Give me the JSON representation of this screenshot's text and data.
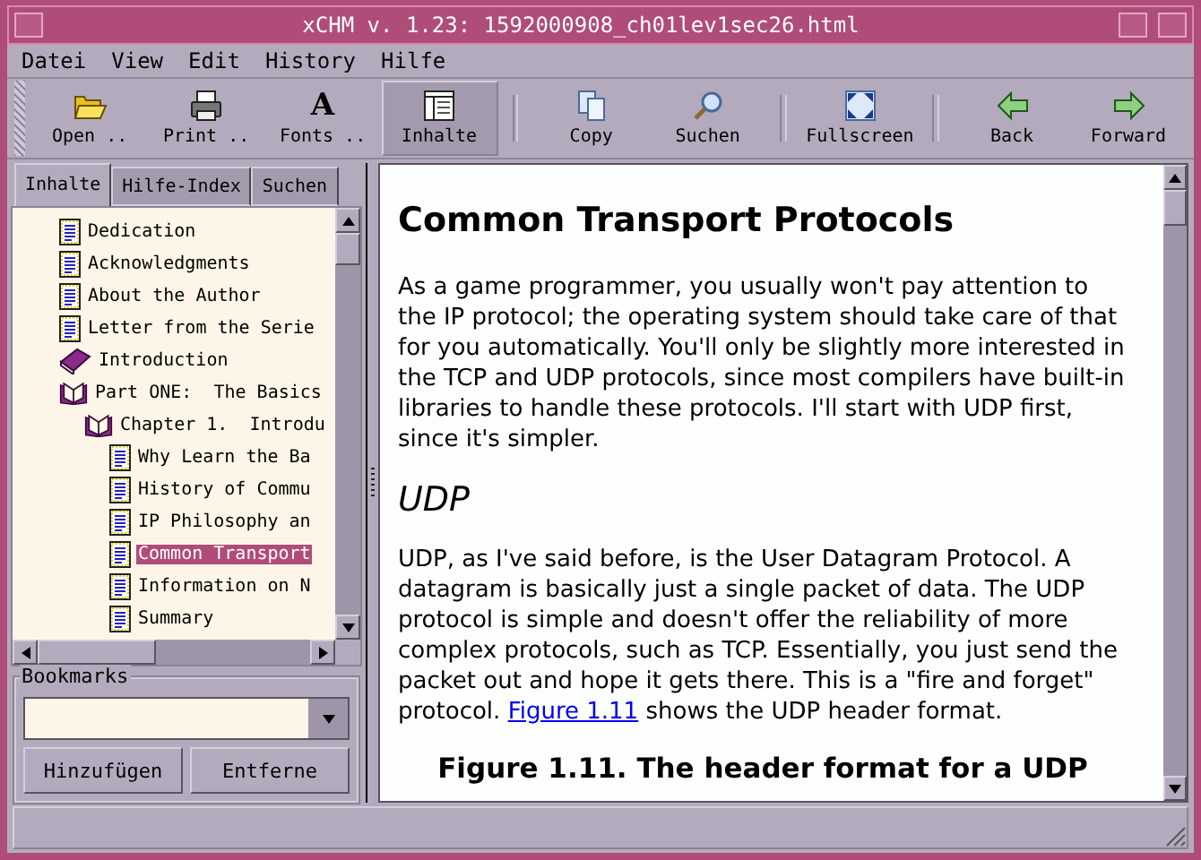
{
  "window": {
    "title": "xCHM v. 1.23: 1592000908_ch01lev1sec26.html"
  },
  "menu": [
    "Datei",
    "View",
    "Edit",
    "History",
    "Hilfe"
  ],
  "toolbar": [
    {
      "kind": "button",
      "label": "Open ..",
      "selected": false
    },
    {
      "kind": "button",
      "label": "Print ..",
      "selected": false
    },
    {
      "kind": "button",
      "glyph": "A",
      "label": "Fonts ..",
      "selected": false
    },
    {
      "kind": "button",
      "label": "Inhalte",
      "selected": true
    },
    {
      "kind": "separator"
    },
    {
      "kind": "button",
      "label": "Copy",
      "selected": false
    },
    {
      "kind": "button",
      "label": "Suchen",
      "selected": false
    },
    {
      "kind": "separator"
    },
    {
      "kind": "button",
      "label": "Fullscreen",
      "selected": false
    },
    {
      "kind": "separator"
    },
    {
      "kind": "button",
      "label": "Back",
      "selected": false
    },
    {
      "kind": "button",
      "label": "Forward",
      "selected": false
    }
  ],
  "sidebar": {
    "tabs": [
      {
        "label": "Inhalte",
        "selected": true
      },
      {
        "label": "Hilfe-Index",
        "selected": false
      },
      {
        "label": "Suchen",
        "selected": false
      }
    ],
    "tree": [
      {
        "kind": "page",
        "label": "Dedication",
        "selected": false
      },
      {
        "kind": "page",
        "label": "Acknowledgments",
        "selected": false
      },
      {
        "kind": "page",
        "label": "About the Author",
        "selected": false
      },
      {
        "kind": "page",
        "label": "Letter from the Serie",
        "selected": false
      },
      {
        "kind": "book",
        "label": "Introduction",
        "selected": false
      },
      {
        "kind": "book-open",
        "label": "Part ONE:  The Basics",
        "selected": false,
        "children": [
          {
            "kind": "book-open",
            "label": "Chapter 1.  Introdu",
            "selected": false,
            "children": [
              {
                "kind": "page",
                "label": "Why Learn the Ba",
                "selected": false
              },
              {
                "kind": "page",
                "label": "History of Commu",
                "selected": false
              },
              {
                "kind": "page",
                "label": "IP Philosophy an",
                "selected": false
              },
              {
                "kind": "page",
                "label": "Common Transport",
                "selected": true
              },
              {
                "kind": "page",
                "label": "Information on N",
                "selected": false
              },
              {
                "kind": "page",
                "label": "Summary",
                "selected": false
              }
            ]
          }
        ]
      }
    ],
    "bookmarks": {
      "label": "Bookmarks",
      "buttons": [
        "Hinzufügen",
        "Entferne"
      ]
    }
  },
  "content": {
    "heading": "Common Transport Protocols",
    "blocks": [
      {
        "kind": "paragraph",
        "text": "As a game programmer, you usually won't pay attention to the IP protocol; the operating system should take care of that for you automatically. You'll only be slightly more interested in the TCP and UDP protocols, since most compilers have built-in libraries to handle these protocols. I'll start with UDP first, since it's simpler."
      },
      {
        "kind": "subheading",
        "text": "UDP"
      },
      {
        "kind": "paragraph",
        "text": "UDP, as I've said before, is the User Datagram Protocol. A datagram is basically just a single packet of data. The UDP protocol is simple and doesn't offer the reliability of more complex protocols, such as TCP. Essentially, you just send the packet out and hope it gets there. This is a \"fire and forget\" protocol.",
        "link": "Figure 1.11",
        "after": "shows the UDP header format."
      },
      {
        "kind": "caption",
        "text": "Figure 1.11. The header format for a UDP"
      }
    ]
  }
}
